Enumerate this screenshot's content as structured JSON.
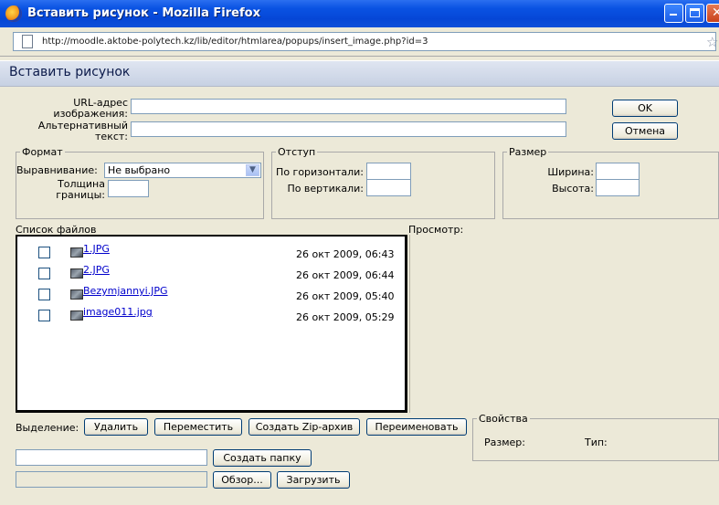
{
  "window": {
    "title": "Вставить рисунок - Mozilla Firefox",
    "url": "http://moodle.aktobe-polytech.kz/lib/editor/htmlarea/popups/insert_image.php?id=3"
  },
  "dialog": {
    "title": "Вставить рисунок",
    "url_label_1": "URL-адрес",
    "url_label_2": "изображения:",
    "alt_label_1": "Альтернативный",
    "alt_label_2": "текст:",
    "url_value": "",
    "alt_value": "",
    "ok_label": "OK",
    "cancel_label": "Отмена"
  },
  "format": {
    "legend": "Формат",
    "align_label": "Выравнивание:",
    "align_value": "Не выбрано",
    "border_label_1": "Толщина",
    "border_label_2": "границы:",
    "border_value": ""
  },
  "spacing": {
    "legend": "Отступ",
    "horizontal_label": "По горизонтали:",
    "vertical_label": "По вертикали:",
    "horizontal_value": "",
    "vertical_value": ""
  },
  "size": {
    "legend": "Размер",
    "width_label": "Ширина:",
    "height_label": "Высота:",
    "width_value": "",
    "height_value": ""
  },
  "files": {
    "list_label": "Список файлов",
    "preview_label": "Просмотр:",
    "items": [
      {
        "name": "1.JPG",
        "date": "26 окт 2009, 06:43"
      },
      {
        "name": "2.JPG",
        "date": "26 окт 2009, 06:44"
      },
      {
        "name": "Bezymjannyi.JPG",
        "date": "26 окт 2009, 05:40"
      },
      {
        "name": "image011.jpg",
        "date": "26 окт 2009, 05:29"
      }
    ]
  },
  "actions": {
    "selection_label": "Выделение:",
    "delete_label": "Удалить",
    "move_label": "Переместить",
    "zip_label": "Создать Zip-архив",
    "rename_label": "Переименовать",
    "mkdir_value": "",
    "mkdir_label": "Создать папку",
    "upload_value": "",
    "browse_label": "Обзор...",
    "upload_label": "Загрузить"
  },
  "properties": {
    "legend": "Свойства",
    "size_label": "Размер:",
    "type_label": "Тип:"
  },
  "colors": {
    "titlebar": "#0a53e3",
    "link": "#0000cc",
    "window_bg": "#ece9d8"
  }
}
